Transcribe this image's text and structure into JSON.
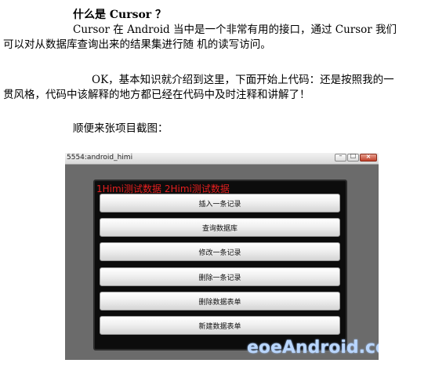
{
  "article": {
    "heading": "什么是 Cursor ？",
    "intro_lines": [
      "Cursor 在 Android 当中是一个非常有用的接口，通过 Cursor 我们",
      "可以对从数据库查询出来的结果集进行随      机的读写访问。"
    ],
    "ok_lines": [
      "OK，基本知识就介绍到这里，下面开始上代码：还是按照我的一",
      "贯风格，代码中该解释的地方都已经在代码中及时注释和讲解了！"
    ],
    "screenshot_caption": "顺便来张项目截图："
  },
  "emulator": {
    "window_title": "5554:android_himi",
    "result_labels": "1Himi测试数据  2Himi测试数据",
    "buttons": [
      {
        "label": "插入一条记录"
      },
      {
        "label": "查询数据库"
      },
      {
        "label": "修改一条记录"
      },
      {
        "label": "删除一条记录"
      },
      {
        "label": "删除数据表单"
      },
      {
        "label": "新建数据表单"
      }
    ],
    "watermark": "eoeAndroid.com"
  }
}
